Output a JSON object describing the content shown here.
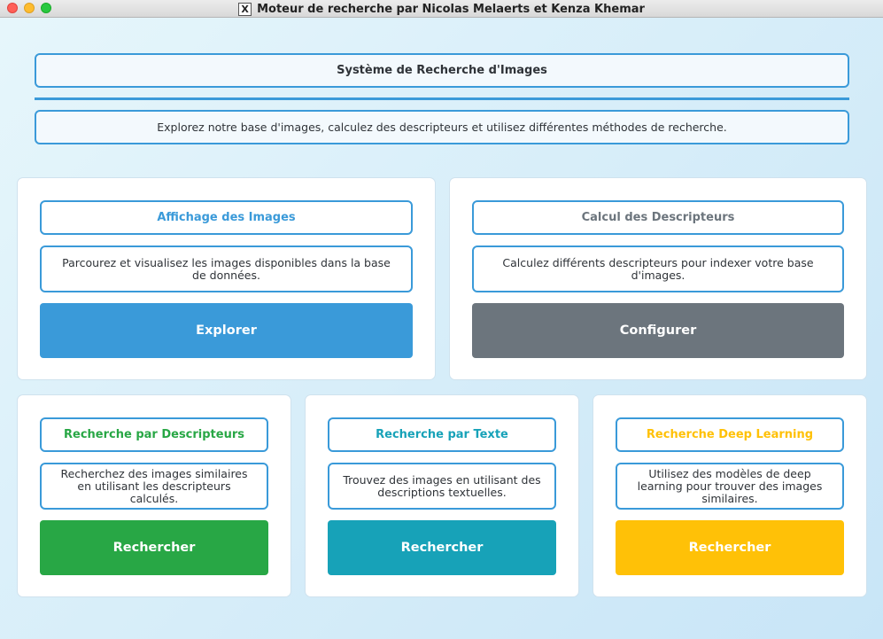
{
  "window": {
    "title": "Moteur de recherche par Nicolas Melaerts et Kenza Khemar",
    "app_icon": "x11-icon"
  },
  "header": {
    "title": "Système de Recherche d'Images",
    "subtitle": "Explorez notre base d'images, calculez des descripteurs et utilisez différentes méthodes de recherche."
  },
  "cards": {
    "images": {
      "title": "Affichage des Images",
      "description": "Parcourez et visualisez les images disponibles dans la base de données.",
      "button": "Explorer",
      "title_color": "#3a9ad9",
      "button_color": "#3a9ad9"
    },
    "descriptors": {
      "title": "Calcul des Descripteurs",
      "description": "Calculez différents descripteurs pour indexer votre base d'images.",
      "button": "Configurer",
      "title_color": "#6c757d",
      "button_color": "#6c757d"
    },
    "search_descriptors": {
      "title": "Recherche par Descripteurs",
      "description": "Recherchez des images similaires en utilisant les descripteurs calculés.",
      "button": "Rechercher",
      "title_color": "#28a745",
      "button_color": "#28a745"
    },
    "search_text": {
      "title": "Recherche par Texte",
      "description": "Trouvez des images en utilisant des descriptions textuelles.",
      "button": "Rechercher",
      "title_color": "#17a2b8",
      "button_color": "#17a2b8"
    },
    "search_deep": {
      "title": "Recherche Deep Learning",
      "description": "Utilisez des modèles de deep learning pour trouver des images similaires.",
      "button": "Rechercher",
      "title_color": "#ffc107",
      "button_color": "#ffc107"
    }
  },
  "colors": {
    "accent_border": "#3a9ad9",
    "background_start": "#e6f6fb",
    "background_end": "#c8e5f7"
  }
}
